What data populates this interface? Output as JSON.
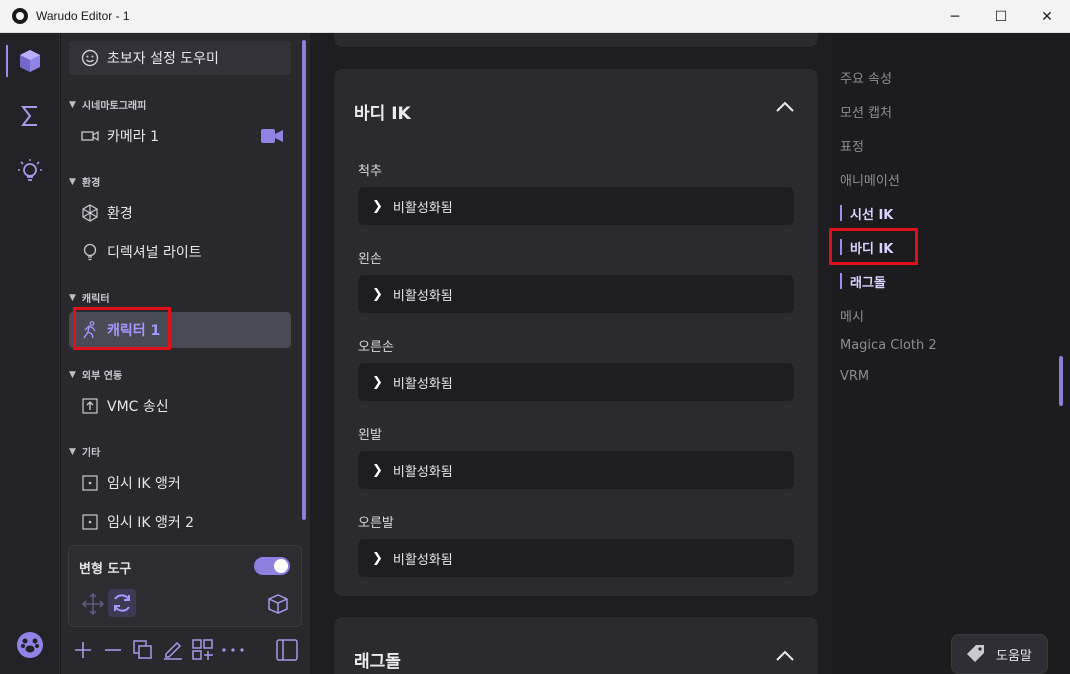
{
  "window": {
    "title": "Warudo Editor - 1",
    "minimize": "─",
    "maximize": "☐",
    "close": "✕"
  },
  "sidebar": {
    "wizard": "초보자 설정 도우미",
    "sections": [
      {
        "label": "시네마토그래피",
        "items": [
          "카메라 1"
        ]
      },
      {
        "label": "환경",
        "items": [
          "환경",
          "디렉셔널 라이트"
        ]
      },
      {
        "label": "캐릭터",
        "items": [
          "캐릭터 1"
        ]
      },
      {
        "label": "외부 연동",
        "items": [
          "VMC 송신"
        ]
      },
      {
        "label": "기타",
        "items": [
          "임시 IK 앵커",
          "임시 IK 앵커 2"
        ]
      }
    ],
    "transform_label": "변형 도구",
    "transform_enabled": true
  },
  "main": {
    "body_ik": {
      "title": "바디 IK",
      "fields": [
        {
          "label": "척추",
          "value": "비활성화됨"
        },
        {
          "label": "왼손",
          "value": "비활성화됨"
        },
        {
          "label": "오른손",
          "value": "비활성화됨"
        },
        {
          "label": "왼발",
          "value": "비활성화됨"
        },
        {
          "label": "오른발",
          "value": "비활성화됨"
        }
      ]
    },
    "ragdoll": {
      "title": "래그돌"
    }
  },
  "toc": {
    "items": [
      "주요 속성",
      "모션 캡처",
      "표정",
      "애니메이션",
      "시선 IK",
      "바디 IK",
      "래그돌",
      "메시",
      "Magica Cloth 2",
      "VRM"
    ],
    "active": [
      "시선 IK",
      "바디 IK",
      "래그돌"
    ]
  },
  "help": {
    "label": "도움말"
  },
  "colors": {
    "accent": "#9a8cf2",
    "highlight": "#e0101a",
    "selected_text": "#a598ff"
  }
}
